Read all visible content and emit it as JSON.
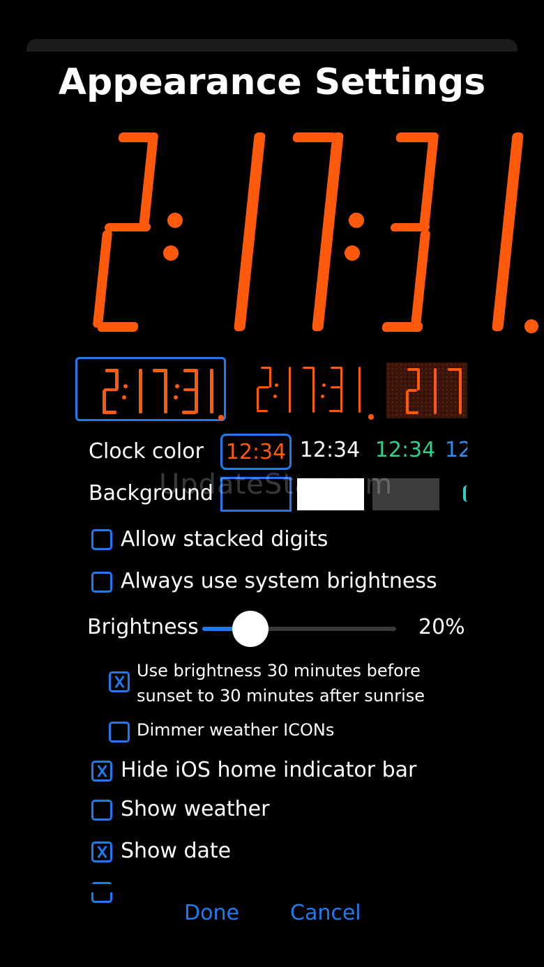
{
  "title": "Appearance Settings",
  "clock": {
    "time": "2:17:31",
    "color": "#ff5a0c"
  },
  "styles": {
    "items": [
      "segment-bold",
      "segment-thin",
      "nixie"
    ]
  },
  "clock_color": {
    "label": "Clock color",
    "options": [
      {
        "text": "12:34",
        "color": "#ff5a0c",
        "selected": true
      },
      {
        "text": "12:34",
        "color": "#ffffff"
      },
      {
        "text": "12:34",
        "color": "#2fd08c"
      },
      {
        "text": "12",
        "color": "#2f8df0"
      }
    ]
  },
  "background": {
    "label": "Background",
    "options": [
      {
        "color": "#000000",
        "selected": true
      },
      {
        "color": "#ffffff"
      },
      {
        "color": "#3c3c3c"
      }
    ]
  },
  "watermark": "UpdateStar.com",
  "options": {
    "allow_stacked": "Allow stacked digits",
    "system_brightness": "Always use system brightness",
    "brightness_label": "Brightness",
    "brightness_value": "20%",
    "brightness_level": 0.2,
    "sunset_line1": "Use brightness 30 minutes before",
    "sunset_line2": "sunset to 30 minutes after sunrise",
    "dimmer_weather": "Dimmer weather ICONs",
    "hide_home": "Hide iOS home indicator bar",
    "show_weather": "Show weather",
    "show_date": "Show date"
  },
  "buttons": {
    "done": "Done",
    "cancel": "Cancel"
  }
}
